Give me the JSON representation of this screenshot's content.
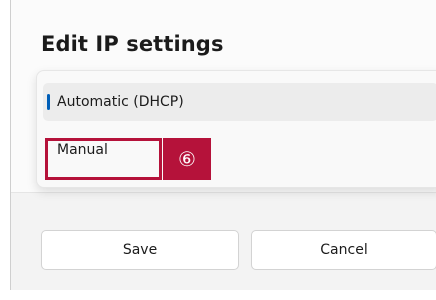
{
  "dialog": {
    "title": "Edit IP settings",
    "dropdown": {
      "options": [
        {
          "label": "Automatic (DHCP)",
          "selected": true
        },
        {
          "label": "Manual",
          "selected": false
        }
      ]
    },
    "callout": {
      "number": "⑥",
      "color": "#b5123a"
    },
    "buttons": {
      "save": "Save",
      "cancel": "Cancel"
    }
  },
  "colors": {
    "accent": "#005fb8",
    "callout": "#b5123a"
  }
}
